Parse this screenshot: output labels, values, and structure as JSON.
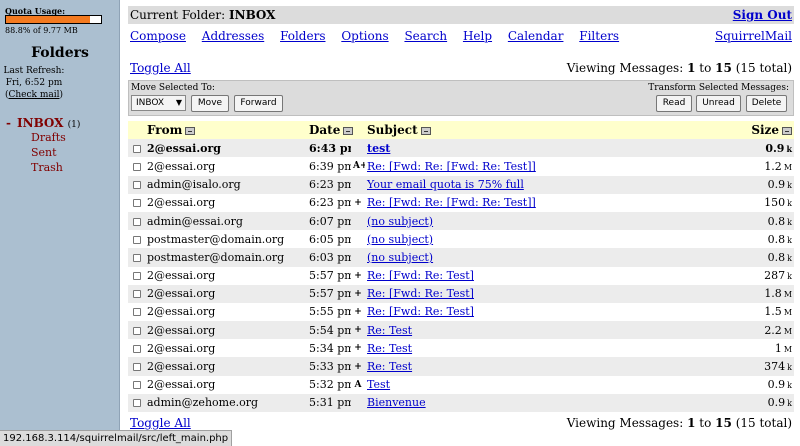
{
  "left": {
    "quota_label": "Quota Usage:",
    "quota_fraction": 0.888,
    "quota_text": "88.8% of 9.77 MB",
    "folders_title": "Folders",
    "last_refresh_label": "Last Refresh:",
    "last_refresh_time": "Fri, 6:52 pm",
    "check_mail": "Check mail",
    "inbox_label": "INBOX",
    "inbox_count": "(1)",
    "subfolders": [
      "Drafts",
      "Sent",
      "Trash"
    ]
  },
  "status_bar": "192.168.3.114/squirrelmail/src/left_main.php",
  "header": {
    "current_folder_label": "Current Folder:",
    "current_folder": "INBOX",
    "sign_out": "Sign Out"
  },
  "menu": {
    "items": [
      "Compose",
      "Addresses",
      "Folders",
      "Options",
      "Search",
      "Help",
      "Calendar",
      "Filters"
    ],
    "brand": "SquirrelMail"
  },
  "toggle_all": "Toggle All",
  "viewing": {
    "prefix": "Viewing Messages:",
    "from": "1",
    "to_word": "to",
    "to": "15",
    "total": "(15 total)"
  },
  "actions": {
    "move_label": "Move Selected To:",
    "transform_label": "Transform Selected Messages:",
    "folder_select": "INBOX",
    "move_button": "Move",
    "forward_button": "Forward",
    "read_button": "Read",
    "unread_button": "Unread",
    "delete_button": "Delete"
  },
  "columns": {
    "from": "From",
    "date": "Date",
    "subject": "Subject",
    "size": "Size"
  },
  "messages": [
    {
      "from": "2@essai.org",
      "date": "6:43 pm",
      "flag": "",
      "subject": "test",
      "size": "0.9",
      "unit": "k",
      "unread": true
    },
    {
      "from": "2@essai.org",
      "date": "6:39 pm",
      "flag": "A+",
      "subject": "Re: [Fwd: Re: [Fwd: Re: Test]]",
      "size": "1.2",
      "unit": "M",
      "unread": false
    },
    {
      "from": "admin@isalo.org",
      "date": "6:23 pm",
      "flag": "",
      "subject": "Your email quota is 75% full",
      "size": "0.9",
      "unit": "k",
      "unread": false
    },
    {
      "from": "2@essai.org",
      "date": "6:23 pm",
      "flag": "+",
      "subject": "Re: [Fwd: Re: [Fwd: Re: Test]]",
      "size": "150",
      "unit": "k",
      "unread": false
    },
    {
      "from": "admin@essai.org",
      "date": "6:07 pm",
      "flag": "",
      "subject": "(no subject)",
      "size": "0.8",
      "unit": "k",
      "unread": false
    },
    {
      "from": "postmaster@domain.org",
      "date": "6:05 pm",
      "flag": "",
      "subject": "(no subject)",
      "size": "0.8",
      "unit": "k",
      "unread": false
    },
    {
      "from": "postmaster@domain.org",
      "date": "6:03 pm",
      "flag": "",
      "subject": "(no subject)",
      "size": "0.8",
      "unit": "k",
      "unread": false
    },
    {
      "from": "2@essai.org",
      "date": "5:57 pm",
      "flag": "+",
      "subject": "Re: [Fwd: Re: Test]",
      "size": "287",
      "unit": "k",
      "unread": false
    },
    {
      "from": "2@essai.org",
      "date": "5:57 pm",
      "flag": "+",
      "subject": "Re: [Fwd: Re: Test]",
      "size": "1.8",
      "unit": "M",
      "unread": false
    },
    {
      "from": "2@essai.org",
      "date": "5:55 pm",
      "flag": "+",
      "subject": "Re: [Fwd: Re: Test]",
      "size": "1.5",
      "unit": "M",
      "unread": false
    },
    {
      "from": "2@essai.org",
      "date": "5:54 pm",
      "flag": "+",
      "subject": "Re: Test",
      "size": "2.2",
      "unit": "M",
      "unread": false
    },
    {
      "from": "2@essai.org",
      "date": "5:34 pm",
      "flag": "+",
      "subject": "Re: Test",
      "size": "1",
      "unit": "M",
      "unread": false
    },
    {
      "from": "2@essai.org",
      "date": "5:33 pm",
      "flag": "+",
      "subject": "Re: Test",
      "size": "374",
      "unit": "k",
      "unread": false
    },
    {
      "from": "2@essai.org",
      "date": "5:32 pm",
      "flag": "A",
      "subject": "Test",
      "size": "0.9",
      "unit": "k",
      "unread": false
    },
    {
      "from": "admin@zehome.org",
      "date": "5:31 pm",
      "flag": "",
      "subject": "Bienvenue",
      "size": "0.9",
      "unit": "k",
      "unread": false
    }
  ]
}
